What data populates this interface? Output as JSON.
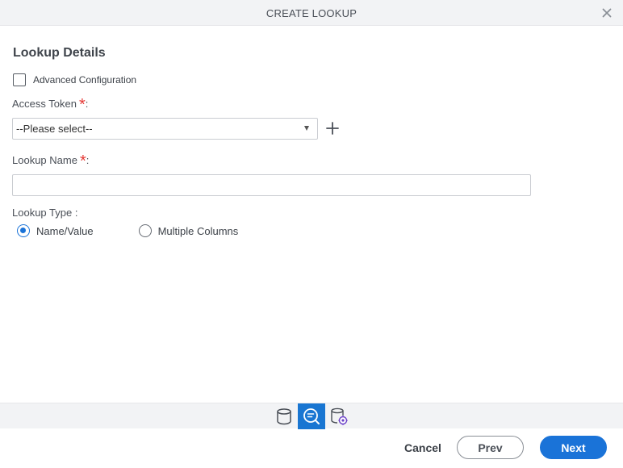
{
  "dialog": {
    "title": "CREATE LOOKUP",
    "close_icon": "close-icon"
  },
  "form": {
    "section_title": "Lookup Details",
    "advanced_configuration": {
      "label": "Advanced Configuration",
      "checked": false
    },
    "access_token": {
      "label": "Access Token",
      "required_mark": "*",
      "colon": ":",
      "selected": "--Please select--",
      "add_icon": "plus-icon"
    },
    "lookup_name": {
      "label": "Lookup Name",
      "required_mark": "*",
      "colon": ":",
      "value": ""
    },
    "lookup_type": {
      "label": "Lookup Type :",
      "options": [
        {
          "label": "Name/Value",
          "checked": true
        },
        {
          "label": "Multiple Columns",
          "checked": false
        }
      ]
    }
  },
  "toolbar": {
    "icons": [
      "database-icon",
      "lookup-search-icon",
      "database-settings-icon"
    ],
    "active_index": 1
  },
  "footer": {
    "cancel_label": "Cancel",
    "prev_label": "Prev",
    "next_label": "Next"
  },
  "colors": {
    "accent": "#1a73d8",
    "required": "#e53935",
    "bar_background": "#f2f3f5"
  }
}
